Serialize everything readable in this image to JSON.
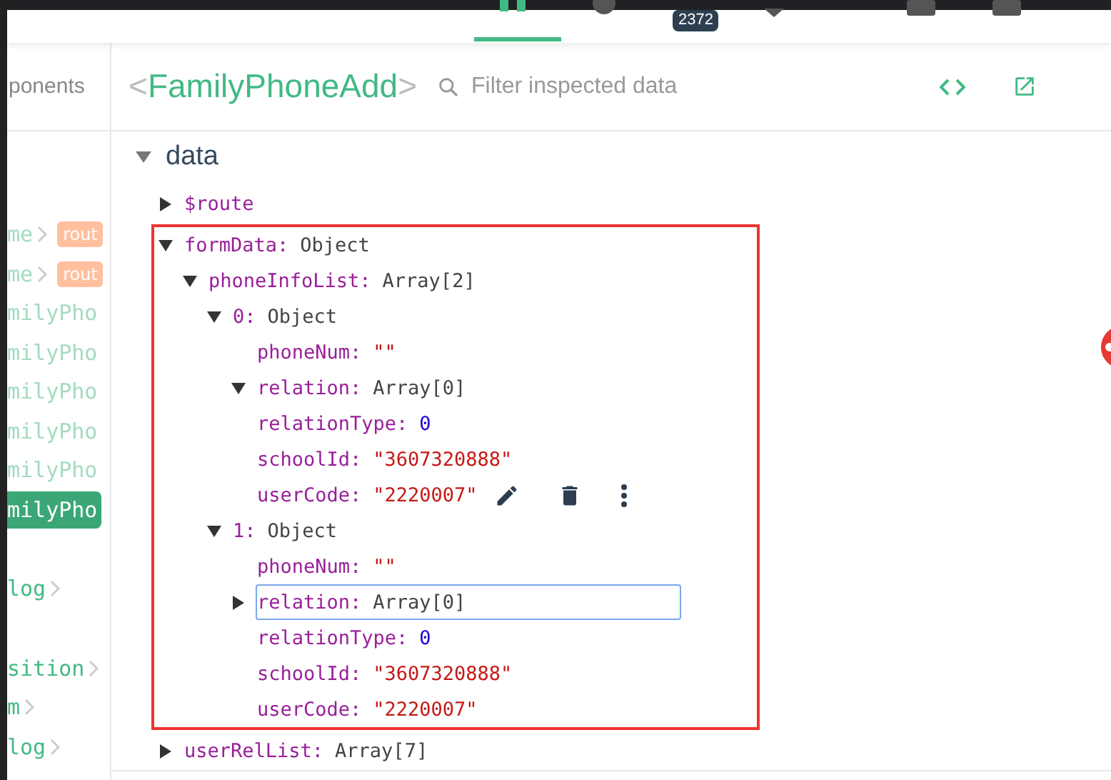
{
  "topbar": {
    "badge": "2372"
  },
  "sidebar": {
    "tab_label": "ponents",
    "items": [
      {
        "label": "me",
        "chevron": true,
        "badge": "rout",
        "dimmed": true,
        "selected": false,
        "gap_before": false
      },
      {
        "label": "me",
        "chevron": true,
        "badge": "rout",
        "dimmed": true,
        "selected": false,
        "gap_before": false
      },
      {
        "label": "milyPho",
        "chevron": false,
        "dimmed": true,
        "selected": false,
        "gap_before": false
      },
      {
        "label": "milyPho",
        "chevron": false,
        "dimmed": true,
        "selected": false,
        "gap_before": false
      },
      {
        "label": "milyPho",
        "chevron": false,
        "dimmed": true,
        "selected": false,
        "gap_before": false
      },
      {
        "label": "milyPho",
        "chevron": false,
        "dimmed": true,
        "selected": false,
        "gap_before": false
      },
      {
        "label": "milyPho",
        "chevron": false,
        "dimmed": true,
        "selected": false,
        "gap_before": false
      },
      {
        "label": "milyPho",
        "chevron": false,
        "dimmed": false,
        "selected": true,
        "gap_before": false
      },
      {
        "label": "log",
        "chevron": true,
        "dimmed": false,
        "selected": false,
        "gap_before": true
      },
      {
        "label": "sition",
        "chevron": true,
        "dimmed": false,
        "selected": false,
        "gap_before": true
      },
      {
        "label": "m",
        "chevron": true,
        "dimmed": false,
        "selected": false,
        "gap_before": false
      },
      {
        "label": "log",
        "chevron": true,
        "dimmed": false,
        "selected": false,
        "gap_before": false
      }
    ]
  },
  "inspector": {
    "open_bracket": "<",
    "component": "FamilyPhoneAdd",
    "close_bracket": ">",
    "search": {
      "placeholder": "Filter inspected data"
    }
  },
  "data_section": {
    "title": "data",
    "expanded": true,
    "nodes": [
      {
        "key": "$route",
        "expanded": false,
        "selected": false,
        "hovered": false,
        "outlined": false
      },
      {
        "key": "formData:",
        "value": "Object",
        "kind": "type",
        "expanded": true,
        "selected": false,
        "hovered": false,
        "outlined": true,
        "children": [
          {
            "key": "phoneInfoList:",
            "value": "Array[2]",
            "kind": "type",
            "expanded": true,
            "selected": false,
            "hovered": false,
            "children": [
              {
                "key": "0:",
                "value": "Object",
                "kind": "type",
                "expanded": true,
                "selected": false,
                "hovered": false,
                "children": [
                  {
                    "key": "phoneNum:",
                    "value": "\"\"",
                    "kind": "string",
                    "selected": false,
                    "hovered": false
                  },
                  {
                    "key": "relation:",
                    "value": "Array[0]",
                    "kind": "type",
                    "expanded": true,
                    "selected": false,
                    "hovered": false
                  },
                  {
                    "key": "relationType:",
                    "value": "0",
                    "kind": "number",
                    "selected": false,
                    "hovered": false
                  },
                  {
                    "key": "schoolId:",
                    "value": "\"3607320888\"",
                    "kind": "string",
                    "selected": false,
                    "hovered": false
                  },
                  {
                    "key": "userCode:",
                    "value": "\"2220007\"",
                    "kind": "string",
                    "selected": false,
                    "hovered": true
                  }
                ]
              },
              {
                "key": "1:",
                "value": "Object",
                "kind": "type",
                "expanded": true,
                "selected": false,
                "hovered": false,
                "children": [
                  {
                    "key": "phoneNum:",
                    "value": "\"\"",
                    "kind": "string",
                    "selected": false,
                    "hovered": false
                  },
                  {
                    "key": "relation:",
                    "value": "Array[0]",
                    "kind": "type",
                    "expanded": false,
                    "selected": true,
                    "hovered": false
                  },
                  {
                    "key": "relationType:",
                    "value": "0",
                    "kind": "number",
                    "selected": false,
                    "hovered": false
                  },
                  {
                    "key": "schoolId:",
                    "value": "\"3607320888\"",
                    "kind": "string",
                    "selected": false,
                    "hovered": false
                  },
                  {
                    "key": "userCode:",
                    "value": "\"2220007\"",
                    "kind": "string",
                    "selected": false,
                    "hovered": false
                  }
                ]
              }
            ]
          }
        ]
      },
      {
        "key": "userRelList:",
        "value": "Array[7]",
        "kind": "type",
        "expanded": false,
        "selected": false,
        "hovered": false,
        "outlined": false
      }
    ]
  }
}
